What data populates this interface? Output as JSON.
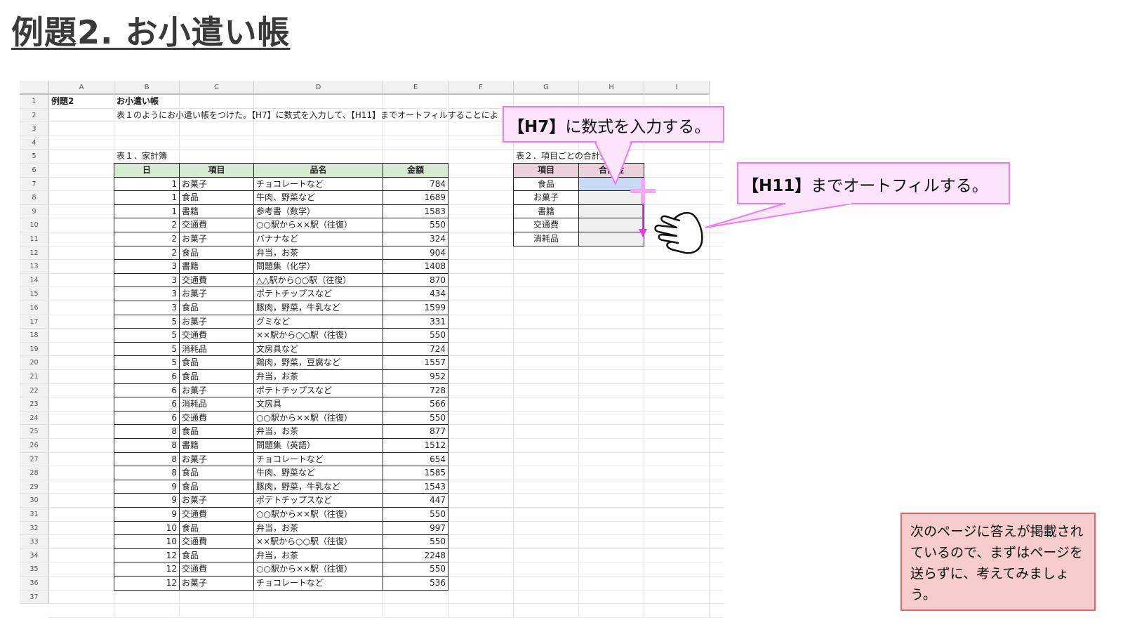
{
  "title": "例題2. お小遣い帳",
  "sheet": {
    "columns": [
      "A",
      "B",
      "C",
      "D",
      "E",
      "F",
      "G",
      "H",
      "I"
    ],
    "row_numbers": [
      "1",
      "2",
      "3",
      "4",
      "5",
      "6",
      "7",
      "8",
      "9",
      "10",
      "11",
      "12",
      "13",
      "14",
      "15",
      "16",
      "17",
      "18",
      "19",
      "20",
      "21",
      "22",
      "23",
      "24",
      "25",
      "26",
      "27",
      "28",
      "29",
      "30",
      "31",
      "32",
      "33",
      "34",
      "35",
      "36",
      "37"
    ],
    "a1": "例題2",
    "b1": "お小遣い帳",
    "b2": "表１のようにお小遣い帳をつけた。【H7】に数式を入力して、【H11】までオートフィルすることによ",
    "table1_title": "表１．家計簿",
    "table1_headers": [
      "日",
      "項目",
      "品名",
      "金額"
    ],
    "table1_rows": [
      [
        "1",
        "お菓子",
        "チョコレートなど",
        "784"
      ],
      [
        "1",
        "食品",
        "牛肉、野菜など",
        "1689"
      ],
      [
        "1",
        "書籍",
        "参考書（数学）",
        "1583"
      ],
      [
        "2",
        "交通費",
        "○○駅から××駅（往復）",
        "550"
      ],
      [
        "2",
        "お菓子",
        "バナナなど",
        "324"
      ],
      [
        "2",
        "食品",
        "弁当，お茶",
        "904"
      ],
      [
        "3",
        "書籍",
        "問題集（化学）",
        "1408"
      ],
      [
        "3",
        "交通費",
        "△△駅から○○駅（往復）",
        "870"
      ],
      [
        "3",
        "お菓子",
        "ポテトチップスなど",
        "434"
      ],
      [
        "3",
        "食品",
        "豚肉，野菜，牛乳など",
        "1599"
      ],
      [
        "5",
        "お菓子",
        "グミなど",
        "331"
      ],
      [
        "5",
        "交通費",
        "××駅から○○駅（往復）",
        "550"
      ],
      [
        "5",
        "消耗品",
        "文房具など",
        "724"
      ],
      [
        "5",
        "食品",
        "鶏肉，野菜，豆腐など",
        "1557"
      ],
      [
        "6",
        "食品",
        "弁当，お茶",
        "952"
      ],
      [
        "6",
        "お菓子",
        "ポテトチップスなど",
        "728"
      ],
      [
        "6",
        "消耗品",
        "文房具",
        "566"
      ],
      [
        "6",
        "交通費",
        "○○駅から××駅（往復）",
        "550"
      ],
      [
        "8",
        "食品",
        "弁当，お茶",
        "877"
      ],
      [
        "8",
        "書籍",
        "問題集（英語）",
        "1512"
      ],
      [
        "8",
        "お菓子",
        "チョコレートなど",
        "654"
      ],
      [
        "8",
        "食品",
        "牛肉、野菜など",
        "1585"
      ],
      [
        "9",
        "食品",
        "豚肉，野菜，牛乳など",
        "1543"
      ],
      [
        "9",
        "お菓子",
        "ポテトチップスなど",
        "447"
      ],
      [
        "9",
        "交通費",
        "○○駅から××駅（往復）",
        "550"
      ],
      [
        "10",
        "食品",
        "弁当，お茶",
        "997"
      ],
      [
        "10",
        "交通費",
        "××駅から○○駅（往復）",
        "550"
      ],
      [
        "12",
        "食品",
        "弁当，お茶",
        "2248"
      ],
      [
        "12",
        "交通費",
        "○○駅から××駅（往復）",
        "550"
      ],
      [
        "12",
        "お菓子",
        "チョコレートなど",
        "536"
      ]
    ],
    "table2_title": "表２．項目ごとの合計金額",
    "table2_headers": [
      "項目",
      "合計金"
    ],
    "table2_items": [
      "食品",
      "お菓子",
      "書籍",
      "交通費",
      "消耗品"
    ]
  },
  "callout_h7": {
    "bold": "【H7】",
    "text": "に数式を入力する。"
  },
  "callout_h11": {
    "bold": "【H11】",
    "text": "までオートフィルする。"
  },
  "note": "次のページに答えが掲載されているので、まずはページを送らずに、考えてみましょう。",
  "colors": {
    "callout_fill": "#fce4fb",
    "callout_border": "#f178f0",
    "note_fill": "#f6cccc",
    "note_border": "#e06666",
    "header_green": "#d9ead3",
    "header_pink": "#ead1dc",
    "selected_cell": "#c9daf8"
  }
}
